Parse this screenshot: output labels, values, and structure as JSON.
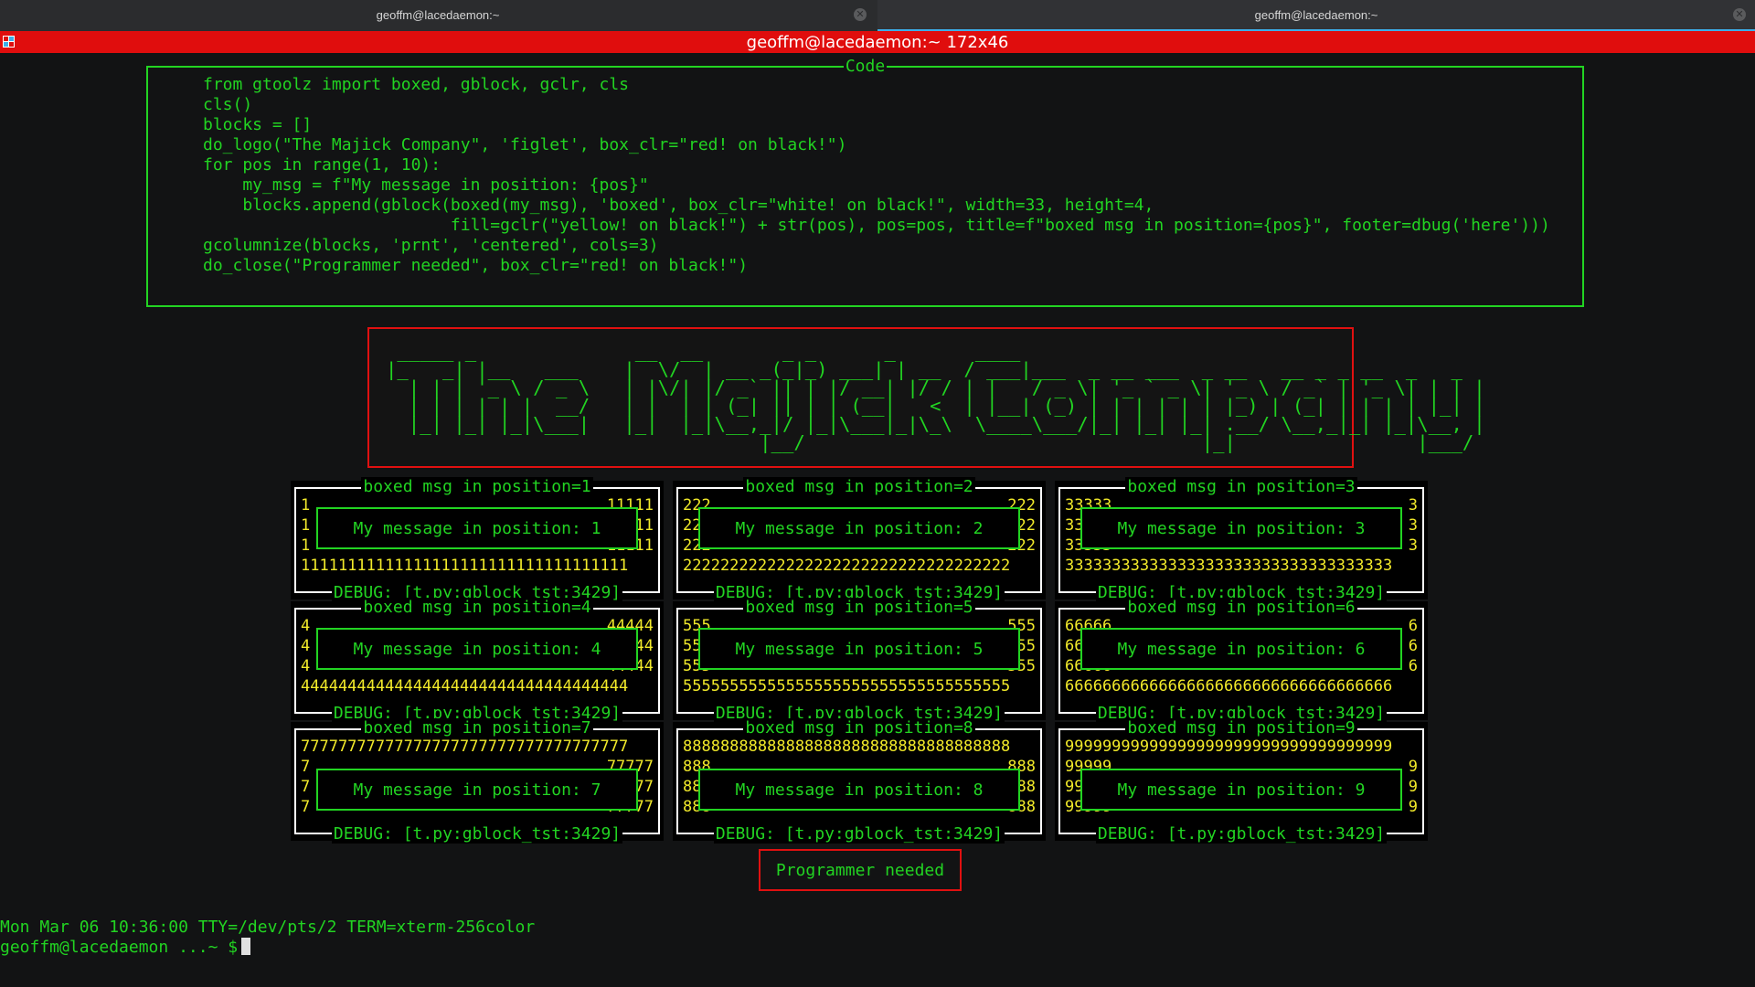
{
  "tabs": [
    {
      "label": "geoffm@lacedaemon:~",
      "active": false
    },
    {
      "label": "geoffm@lacedaemon:~",
      "active": true
    }
  ],
  "titlebar": {
    "title": "geoffm@lacedaemon:~ 172x46",
    "color": "#e00d0d"
  },
  "code_box": {
    "title": "Code",
    "lines": [
      "from gtoolz import boxed, gblock, gclr, cls",
      "cls()",
      "blocks = []",
      "do_logo(\"The Majick Company\", 'figlet', box_clr=\"red! on black!\")",
      "for pos in range(1, 10):",
      "    my_msg = f\"My message in position: {pos}\"",
      "    blocks.append(gblock(boxed(my_msg), 'boxed', box_clr=\"white! on black!\", width=33, height=4,",
      "                         fill=gclr(\"yellow! on black!\") + str(pos), pos=pos, title=f\"boxed msg in position={pos}\", footer=dbug('here')))",
      "gcolumnize(blocks, 'prnt', 'centered', cols=3)",
      "do_close(\"Programmer needed\", box_clr=\"red! on black!\")"
    ]
  },
  "logo": {
    "text": "The Majick Company",
    "ascii_lines": [
      " _____ _              __  __       _ _      _       ____",
      "|_   _| |__   ___    |  \\/  | __ _(_|_) ___| | __  / ___|___  _ __ ___  _ __   __ _ _ __  _   _",
      "  | | | '_ \\ / _ \\   | |\\/| |/ _` || | |/ __| |/ / | |   / _ \\| '_ ` _ \\| '_ \\ / _` | '_ \\| | | |",
      "  | | | | | |  __/   | |  | | (_| || | | (__|   <  | |__| (_) | | | | | | |_) | (_| | | | | |_| |",
      "  |_| |_| |_|\\___|   |_|  |_|\\__,_|/ |_|\\___|_|\\_\\  \\____\\___/|_| |_| |_| .__/ \\__,_|_| |_|\\__, |",
      "                                 |__/                                   |_|                |___/"
    ]
  },
  "blocks": [
    {
      "title": "boxed msg in position=1",
      "message": "My message in position: 1",
      "footer": "DEBUG: [t.py:gblock_tst:3429]",
      "rows": [
        [
          "1",
          "11111"
        ],
        [
          "1",
          "11111"
        ],
        [
          "1",
          "11111"
        ]
      ],
      "full_row": "11111111111111111111111111111111111",
      "full_row_position": "bottom"
    },
    {
      "title": "boxed msg in position=2",
      "message": "My message in position: 2",
      "footer": "DEBUG: [t.py:gblock_tst:3429]",
      "rows": [
        [
          "222",
          "222"
        ],
        [
          "222",
          "222"
        ],
        [
          "222",
          "222"
        ]
      ],
      "full_row": "22222222222222222222222222222222222",
      "full_row_position": "bottom"
    },
    {
      "title": "boxed msg in position=3",
      "message": "My message in position: 3",
      "footer": "DEBUG: [t.py:gblock_tst:3429]",
      "rows": [
        [
          "33333",
          "3"
        ],
        [
          "33333",
          "3"
        ],
        [
          "33333",
          "3"
        ]
      ],
      "full_row": "33333333333333333333333333333333333",
      "full_row_position": "bottom"
    },
    {
      "title": "boxed msg in position=4",
      "message": "My message in position: 4",
      "footer": "DEBUG: [t.py:gblock_tst:3429]",
      "rows": [
        [
          "4",
          "44444"
        ],
        [
          "4",
          "44444"
        ],
        [
          "4",
          "44444"
        ]
      ],
      "full_row": "44444444444444444444444444444444444",
      "full_row_position": "bottom"
    },
    {
      "title": "boxed msg in position=5",
      "message": "My message in position: 5",
      "footer": "DEBUG: [t.py:gblock_tst:3429]",
      "rows": [
        [
          "555",
          "555"
        ],
        [
          "555",
          "555"
        ],
        [
          "555",
          "555"
        ]
      ],
      "full_row": "55555555555555555555555555555555555",
      "full_row_position": "bottom"
    },
    {
      "title": "boxed msg in position=6",
      "message": "My message in position: 6",
      "footer": "DEBUG: [t.py:gblock_tst:3429]",
      "rows": [
        [
          "66666",
          "6"
        ],
        [
          "66666",
          "6"
        ],
        [
          "66666",
          "6"
        ]
      ],
      "full_row": "66666666666666666666666666666666666",
      "full_row_position": "bottom"
    },
    {
      "title": "boxed msg in position=7",
      "message": "My message in position: 7",
      "footer": "DEBUG: [t.py:gblock_tst:3429]",
      "rows": [
        [
          "7",
          "77777"
        ],
        [
          "7",
          "77777"
        ],
        [
          "7",
          "77777"
        ]
      ],
      "full_row": "77777777777777777777777777777777777",
      "full_row_position": "top"
    },
    {
      "title": "boxed msg in position=8",
      "message": "My message in position: 8",
      "footer": "DEBUG: [t.py:gblock_tst:3429]",
      "rows": [
        [
          "888",
          "888"
        ],
        [
          "888",
          "888"
        ],
        [
          "888",
          "888"
        ]
      ],
      "full_row": "88888888888888888888888888888888888",
      "full_row_position": "top"
    },
    {
      "title": "boxed msg in position=9",
      "message": "My message in position: 9",
      "footer": "DEBUG: [t.py:gblock_tst:3429]",
      "rows": [
        [
          "99999",
          "9"
        ],
        [
          "99999",
          "9"
        ],
        [
          "99999",
          "9"
        ]
      ],
      "full_row": "99999999999999999999999999999999999",
      "full_row_position": "top"
    }
  ],
  "close_box": {
    "text": "Programmer needed"
  },
  "status_line": "Mon Mar 06 10:36:00 TTY=/dev/pts/2 TERM=xterm-256color",
  "prompt": "geoffm@lacedaemon ...~ $",
  "colors": {
    "green": "#22d422",
    "yellow": "#f2ea2a",
    "red": "#e01010",
    "white": "#ffffff",
    "tab_accent": "#3daee9"
  }
}
